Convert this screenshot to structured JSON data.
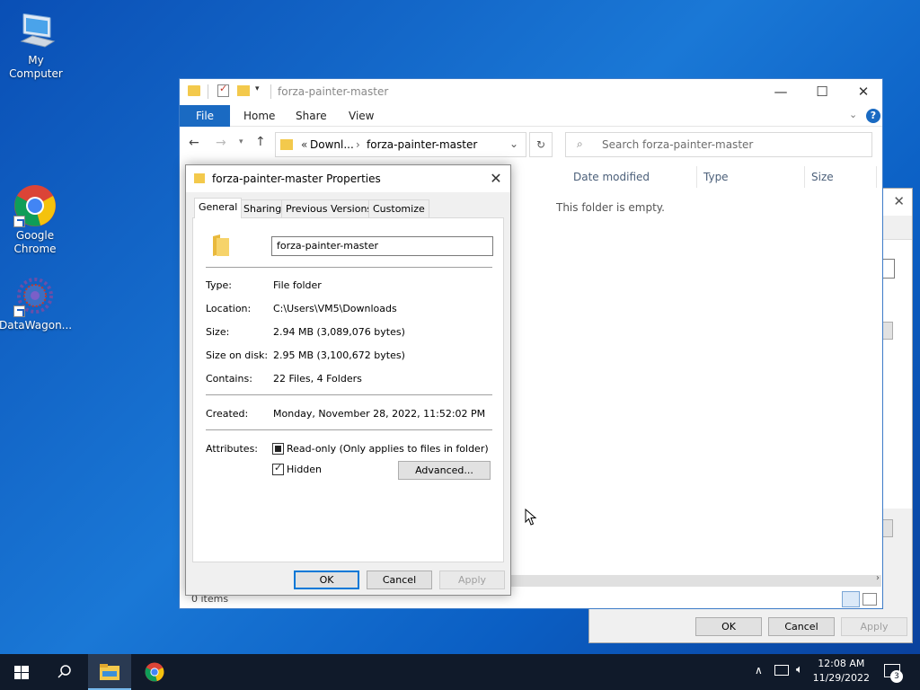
{
  "desktop": {
    "icons": [
      {
        "label": "My Computer"
      },
      {
        "label": "Google Chrome"
      },
      {
        "label": "DataWagon..."
      }
    ]
  },
  "explorer": {
    "title": "forza-painter-master",
    "tabs": [
      "File",
      "Home",
      "Share",
      "View"
    ],
    "breadcrumb": {
      "prefix": "«",
      "parent": "Downl...",
      "separator": "›",
      "current": "forza-painter-master"
    },
    "search_placeholder": "Search forza-painter-master",
    "columns": [
      "Date modified",
      "Type",
      "Size"
    ],
    "empty_message": "This folder is empty.",
    "status_items": "0 items",
    "window_buttons": {
      "minimize": "—",
      "maximize": "☐",
      "close": "✕"
    }
  },
  "bg_dialog": {
    "ok": "OK",
    "cancel": "Cancel",
    "apply": "Apply",
    "close": "✕"
  },
  "properties": {
    "title": "forza-painter-master Properties",
    "tabs": [
      "General",
      "Sharing",
      "Previous Versions",
      "Customize"
    ],
    "folder_name": "forza-painter-master",
    "fields": {
      "type_label": "Type:",
      "type_value": "File folder",
      "location_label": "Location:",
      "location_value": "C:\\Users\\VM5\\Downloads",
      "size_label": "Size:",
      "size_value": "2.94 MB (3,089,076 bytes)",
      "size_on_disk_label": "Size on disk:",
      "size_on_disk_value": "2.95 MB (3,100,672 bytes)",
      "contains_label": "Contains:",
      "contains_value": "22 Files, 4 Folders",
      "created_label": "Created:",
      "created_value": "Monday, November 28, 2022, 11:52:02 PM",
      "attributes_label": "Attributes:"
    },
    "attributes": {
      "readonly_label": "Read-only (Only applies to files in folder)",
      "readonly_state": "indeterminate",
      "hidden_label": "Hidden",
      "hidden_state": "checked",
      "advanced_label": "Advanced..."
    },
    "buttons": {
      "ok": "OK",
      "cancel": "Cancel",
      "apply": "Apply"
    },
    "close": "✕"
  },
  "taskbar": {
    "time": "12:08 AM",
    "date": "11/29/2022",
    "notification_count": "3"
  },
  "colors": {
    "accent": "#1a6ac2",
    "taskbar": "#101a2a",
    "folder": "#f3c94c"
  }
}
